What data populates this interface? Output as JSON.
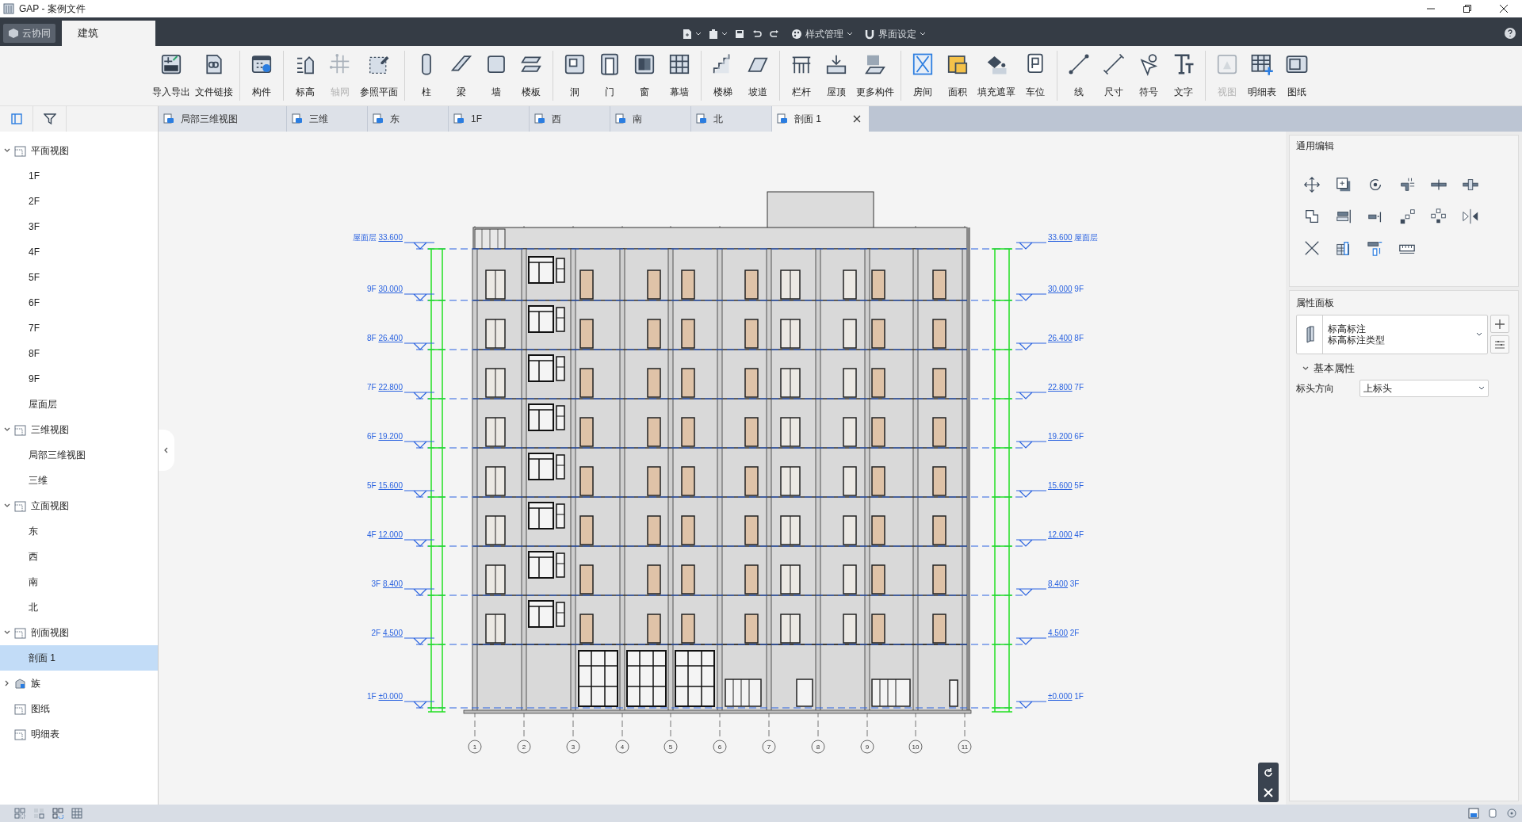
{
  "window": {
    "title": "GAP - 案例文件"
  },
  "top_tabs": [
    {
      "label": "云协同",
      "selected": false
    },
    {
      "label": "建筑",
      "selected": true
    }
  ],
  "quick_toolbar": {
    "menus": [
      "样式管理",
      "界面设定"
    ]
  },
  "ribbon": {
    "groups": [
      {
        "buttons": [
          {
            "label": "导入导出",
            "disabled": false
          },
          {
            "label": "文件链接",
            "disabled": false
          }
        ]
      },
      {
        "buttons": [
          {
            "label": "构件",
            "disabled": false
          }
        ]
      },
      {
        "buttons": [
          {
            "label": "标高",
            "disabled": false
          },
          {
            "label": "轴网",
            "disabled": true
          },
          {
            "label": "参照平面",
            "disabled": false
          }
        ]
      },
      {
        "buttons": [
          {
            "label": "柱",
            "disabled": false
          },
          {
            "label": "梁",
            "disabled": false
          },
          {
            "label": "墙",
            "disabled": false
          },
          {
            "label": "楼板",
            "disabled": false
          }
        ]
      },
      {
        "buttons": [
          {
            "label": "洞",
            "disabled": false
          },
          {
            "label": "门",
            "disabled": false
          },
          {
            "label": "窗",
            "disabled": false
          },
          {
            "label": "幕墙",
            "disabled": false
          }
        ]
      },
      {
        "buttons": [
          {
            "label": "楼梯",
            "disabled": false
          },
          {
            "label": "坡道",
            "disabled": false
          }
        ]
      },
      {
        "buttons": [
          {
            "label": "栏杆",
            "disabled": false
          },
          {
            "label": "屋顶",
            "disabled": false
          },
          {
            "label": "更多构件",
            "disabled": false
          }
        ]
      },
      {
        "buttons": [
          {
            "label": "房间",
            "disabled": false
          },
          {
            "label": "面积",
            "disabled": false
          },
          {
            "label": "填充遮罩",
            "disabled": false
          },
          {
            "label": "车位",
            "disabled": false
          }
        ]
      },
      {
        "buttons": [
          {
            "label": "线",
            "disabled": false
          },
          {
            "label": "尺寸",
            "disabled": false
          },
          {
            "label": "符号",
            "disabled": false
          },
          {
            "label": "文字",
            "disabled": false
          }
        ]
      },
      {
        "buttons": [
          {
            "label": "视图",
            "disabled": true
          },
          {
            "label": "明细表",
            "disabled": false
          },
          {
            "label": "图纸",
            "disabled": false
          }
        ]
      }
    ]
  },
  "view_tabs": [
    {
      "label": "局部三维视图",
      "selected": false,
      "closable": false
    },
    {
      "label": "三维",
      "selected": false,
      "closable": false
    },
    {
      "label": "东",
      "selected": false,
      "closable": false
    },
    {
      "label": "1F",
      "selected": false,
      "closable": false
    },
    {
      "label": "西",
      "selected": false,
      "closable": false
    },
    {
      "label": "南",
      "selected": false,
      "closable": false
    },
    {
      "label": "北",
      "selected": false,
      "closable": false
    },
    {
      "label": "剖面 1",
      "selected": true,
      "closable": true
    }
  ],
  "project_tree": [
    {
      "label": "平面视图",
      "kind": "views",
      "expanded": true,
      "selected": false,
      "children": [
        {
          "label": "1F",
          "selected": false
        },
        {
          "label": "2F",
          "selected": false
        },
        {
          "label": "3F",
          "selected": false
        },
        {
          "label": "4F",
          "selected": false
        },
        {
          "label": "5F",
          "selected": false
        },
        {
          "label": "6F",
          "selected": false
        },
        {
          "label": "7F",
          "selected": false
        },
        {
          "label": "8F",
          "selected": false
        },
        {
          "label": "9F",
          "selected": false
        },
        {
          "label": "屋面层",
          "selected": false
        }
      ]
    },
    {
      "label": "三维视图",
      "kind": "views",
      "expanded": true,
      "selected": false,
      "children": [
        {
          "label": "局部三维视图",
          "selected": false
        },
        {
          "label": "三维",
          "selected": false
        }
      ]
    },
    {
      "label": "立面视图",
      "kind": "views",
      "expanded": true,
      "selected": false,
      "children": [
        {
          "label": "东",
          "selected": false
        },
        {
          "label": "西",
          "selected": false
        },
        {
          "label": "南",
          "selected": false
        },
        {
          "label": "北",
          "selected": false
        }
      ]
    },
    {
      "label": "剖面视图",
      "kind": "views",
      "expanded": true,
      "selected": false,
      "children": [
        {
          "label": "剖面 1",
          "selected": true
        }
      ]
    },
    {
      "label": "族",
      "kind": "family",
      "expanded": false,
      "selected": false
    },
    {
      "label": "图纸",
      "kind": "views",
      "selected": false
    },
    {
      "label": "明细表",
      "kind": "views",
      "selected": false
    }
  ],
  "drawing": {
    "left_levels": [
      {
        "name": "屋面层",
        "elevation": "33.600"
      },
      {
        "name": "9F",
        "elevation": "30.000"
      },
      {
        "name": "8F",
        "elevation": "26.400"
      },
      {
        "name": "7F",
        "elevation": "22.800"
      },
      {
        "name": "6F",
        "elevation": "19.200"
      },
      {
        "name": "5F",
        "elevation": "15.600"
      },
      {
        "name": "4F",
        "elevation": "12.000"
      },
      {
        "name": "3F",
        "elevation": "8.400"
      },
      {
        "name": "2F",
        "elevation": "4.500"
      },
      {
        "name": "1F",
        "elevation": "±0.000"
      }
    ],
    "right_levels": [
      {
        "name": "屋面层",
        "elevation": "33.600"
      },
      {
        "name": "9F",
        "elevation": "30.000"
      },
      {
        "name": "8F",
        "elevation": "26.400"
      },
      {
        "name": "7F",
        "elevation": "22.800"
      },
      {
        "name": "6F",
        "elevation": "19.200"
      },
      {
        "name": "5F",
        "elevation": "15.600"
      },
      {
        "name": "4F",
        "elevation": "12.000"
      },
      {
        "name": "3F",
        "elevation": "8.400"
      },
      {
        "name": "2F",
        "elevation": "4.500"
      },
      {
        "name": "1F",
        "elevation": "±0.000"
      }
    ],
    "axes": [
      "1",
      "2",
      "3",
      "4",
      "5",
      "6",
      "7",
      "8",
      "9",
      "10",
      "11"
    ]
  },
  "edit_panel": {
    "title": "通用编辑"
  },
  "properties_panel": {
    "title": "属性面板",
    "type_name": "标高标注",
    "type_subname": "标高标注类型",
    "sections": [
      {
        "title": "基本属性",
        "expanded": true,
        "rows": [
          {
            "label": "标头方向",
            "value": "上标头"
          }
        ]
      }
    ]
  }
}
